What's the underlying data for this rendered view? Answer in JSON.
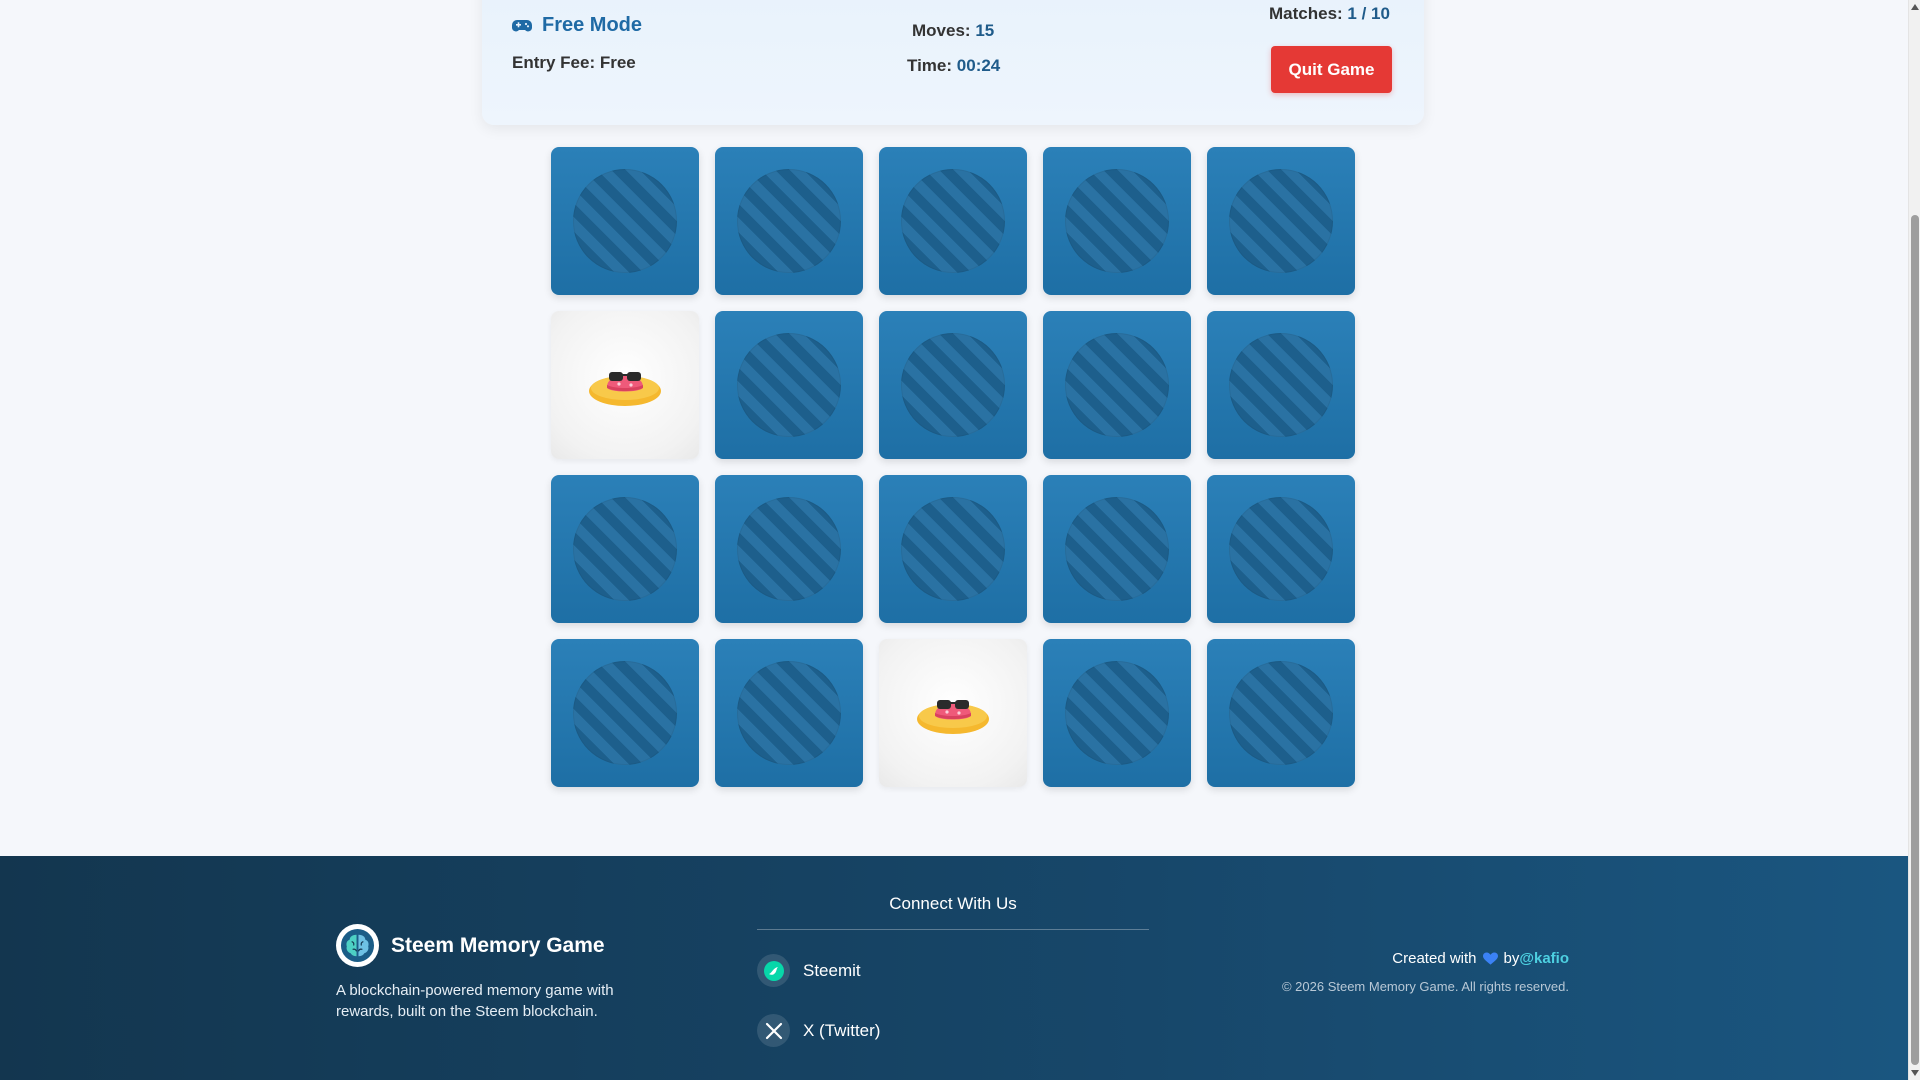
{
  "header": {
    "mode_title": "Free Mode",
    "entry_fee_label": "Entry Fee: Free",
    "moves_label": "Moves:",
    "moves_value": "15",
    "time_label": "Time:",
    "time_value": "00:24",
    "matches_label": "Matches:",
    "matches_value": "1 / 10",
    "quit_label": "Quit Game",
    "icon": "gamepad-icon"
  },
  "board": {
    "columns": 5,
    "rows": 4,
    "cards": [
      {
        "state": "back"
      },
      {
        "state": "back"
      },
      {
        "state": "back"
      },
      {
        "state": "back"
      },
      {
        "state": "back"
      },
      {
        "state": "face",
        "icon": "hat-sunglasses-emoji"
      },
      {
        "state": "back"
      },
      {
        "state": "back"
      },
      {
        "state": "back"
      },
      {
        "state": "back"
      },
      {
        "state": "back"
      },
      {
        "state": "back"
      },
      {
        "state": "back"
      },
      {
        "state": "back"
      },
      {
        "state": "back"
      },
      {
        "state": "back"
      },
      {
        "state": "back"
      },
      {
        "state": "face",
        "icon": "hat-sunglasses-emoji"
      },
      {
        "state": "back"
      },
      {
        "state": "back"
      }
    ]
  },
  "footer": {
    "brand_name": "Steem Memory Game",
    "brand_desc": "A blockchain-powered memory game with rewards, built on the Steem blockchain.",
    "connect_title": "Connect With Us",
    "links": [
      {
        "label": "Steemit",
        "icon": "steemit-icon"
      },
      {
        "label": "X (Twitter)",
        "icon": "x-twitter-icon"
      }
    ],
    "created_with": "Created with",
    "by": "by",
    "author": "@kafio",
    "copyright": "© 2026 Steem Memory Game. All rights reserved."
  },
  "colors": {
    "accent": "#1f6aa5",
    "quit_button": "#e53935",
    "card_back": "#2373ab",
    "footer_bg": "#13364f",
    "author_link": "#4dd0e1"
  }
}
